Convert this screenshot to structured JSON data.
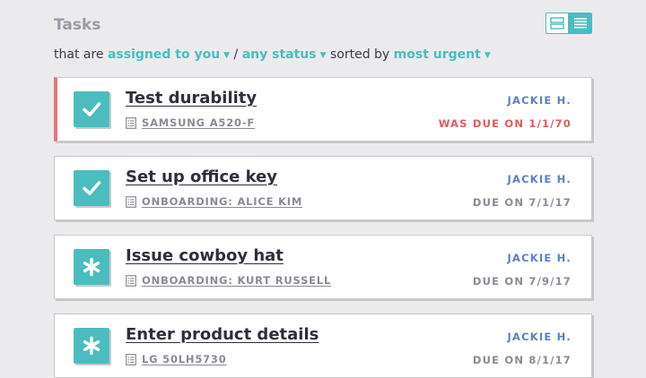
{
  "header": {
    "title": "Tasks"
  },
  "filters": {
    "prefix": "that are",
    "assignment": "assigned to you",
    "separator": "/",
    "status": "any status",
    "sort_prefix": "sorted by",
    "sort": "most urgent"
  },
  "tasks": [
    {
      "title": "Test durability",
      "source": "SAMSUNG A520-F",
      "assignee": "JACKIE H.",
      "due": "WAS DUE ON 1/1/70",
      "overdue": true,
      "status": "completed",
      "status_icon": "check-icon"
    },
    {
      "title": "Set up office key",
      "source": "ONBOARDING: ALICE KIM",
      "assignee": "JACKIE H.",
      "due": "DUE ON 7/1/17",
      "overdue": false,
      "status": "completed",
      "status_icon": "check-icon"
    },
    {
      "title": "Issue cowboy hat",
      "source": "ONBOARDING: KURT RUSSELL",
      "assignee": "JACKIE H.",
      "due": "DUE ON 7/9/17",
      "overdue": false,
      "status": "open",
      "status_icon": "asterisk-icon"
    },
    {
      "title": "Enter product details",
      "source": "LG 50LH5730",
      "assignee": "JACKIE H.",
      "due": "DUE ON 8/1/17",
      "overdue": false,
      "status": "open",
      "status_icon": "asterisk-icon"
    }
  ],
  "colors": {
    "accent": "#4bbdbf",
    "overdue": "#e05a5a",
    "overdue_border": "#e8727a",
    "assignee": "#5b7fc7",
    "background": "#ebebed"
  }
}
